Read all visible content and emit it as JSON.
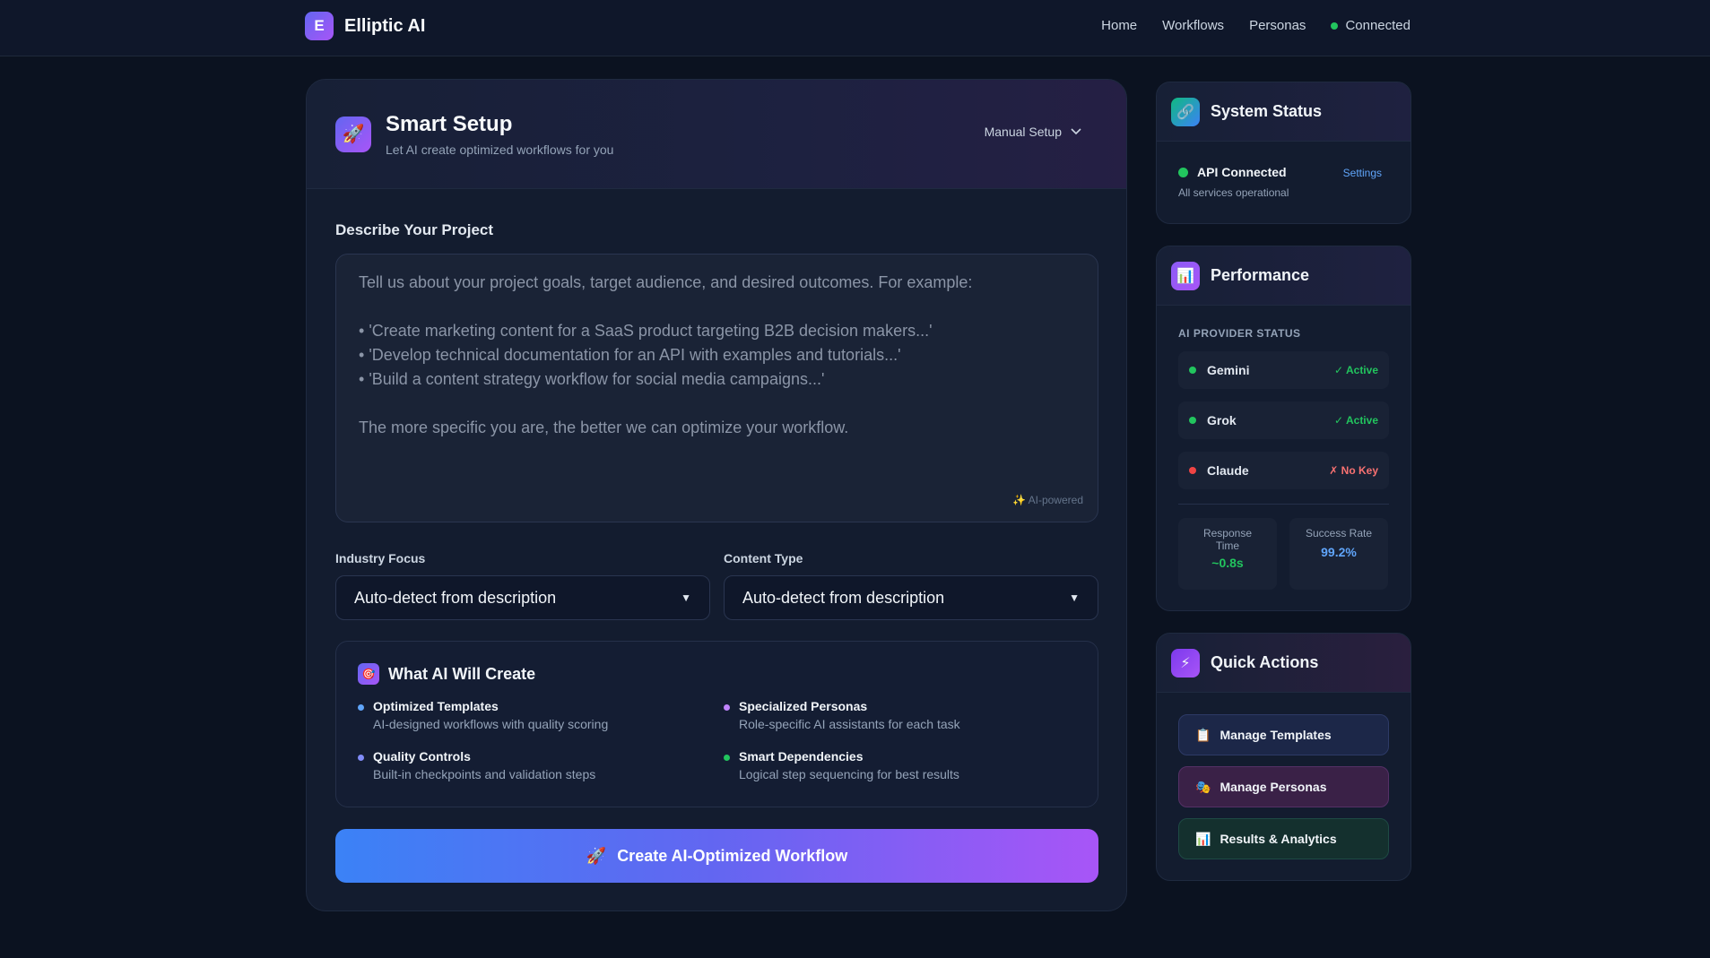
{
  "app": {
    "logo_letter": "E",
    "name": "Elliptic AI"
  },
  "nav": {
    "items": [
      "Home",
      "Workflows",
      "Personas"
    ],
    "status": "Connected"
  },
  "smart_setup": {
    "title": "Smart Setup",
    "subtitle": "Let AI create optimized workflows for you",
    "mode": "Manual Setup",
    "describe_label": "Describe Your Project",
    "placeholder_intro": "Tell us about your project goals, target audience, and desired outcomes. For example:",
    "placeholder_examples": [
      "'Create marketing content for a SaaS product targeting B2B decision makers...'",
      "'Develop technical documentation for an API with examples and tutorials...'",
      "'Build a content strategy workflow for social media campaigns...'"
    ],
    "placeholder_outro": "The more specific you are, the better we can optimize your workflow.",
    "ai_powered": "✨ AI-powered",
    "industry_label": "Industry Focus",
    "industry_value": "Auto-detect from description",
    "content_label": "Content Type",
    "content_value": "Auto-detect from description",
    "what_title": "What AI Will Create",
    "features": [
      {
        "title": "Optimized Templates",
        "desc": "AI-designed workflows with quality scoring",
        "color": "#60a5fa"
      },
      {
        "title": "Specialized Personas",
        "desc": "Role-specific AI assistants for each task",
        "color": "#c084fc"
      },
      {
        "title": "Quality Controls",
        "desc": "Built-in checkpoints and validation steps",
        "color": "#818cf8"
      },
      {
        "title": "Smart Dependencies",
        "desc": "Logical step sequencing for best results",
        "color": "#22c55e"
      }
    ],
    "cta": "Create AI-Optimized Workflow"
  },
  "system_status": {
    "title": "System Status",
    "api": "API Connected",
    "api_sub": "All services operational",
    "settings": "Settings"
  },
  "performance": {
    "title": "Performance",
    "section": "AI PROVIDER STATUS",
    "providers": [
      {
        "name": "Gemini",
        "status": "✓ Active"
      },
      {
        "name": "Grok",
        "status": "✓ Active"
      },
      {
        "name": "Claude",
        "status": "✗ No Key"
      }
    ],
    "response_label_1": "Response",
    "response_label_2": "Time",
    "response_value": "~0.8s",
    "success_label": "Success Rate",
    "success_value": "99.2%"
  },
  "quick_actions": {
    "title": "Quick Actions",
    "buttons": [
      "Manage Templates",
      "Manage Personas",
      "Results & Analytics"
    ]
  },
  "colors": {
    "accent": "#6366f1",
    "success": "#22c55e",
    "danger": "#ef4444",
    "link": "#60a5fa"
  }
}
